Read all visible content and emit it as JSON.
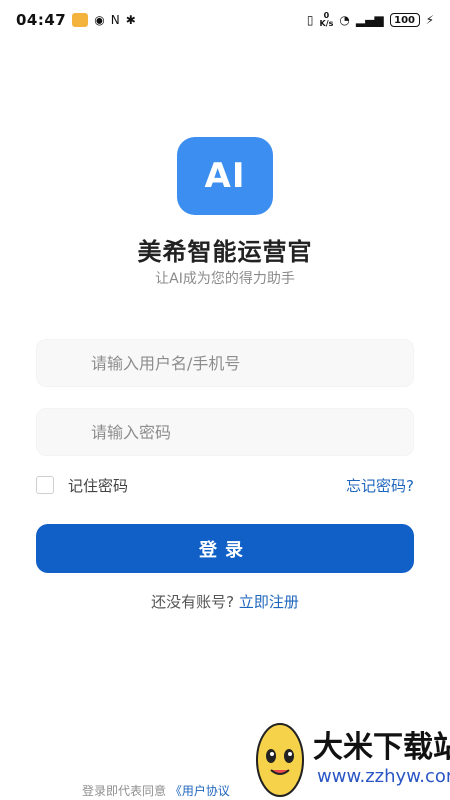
{
  "status_bar": {
    "time": "04:47",
    "speed_value": "0",
    "speed_unit": "K/s",
    "battery": "100"
  },
  "logo": {
    "text": "AI",
    "color": "#3c8ef0"
  },
  "app": {
    "name": "美希智能运营官",
    "tagline": "让AI成为您的得力助手"
  },
  "form": {
    "username_placeholder": "请输入用户名/手机号",
    "password_placeholder": "请输入密码",
    "remember_label": "记住密码",
    "forgot_link": "忘记密码?",
    "login_button": "登录",
    "no_account_text": "还没有账号?",
    "register_link": "立即注册"
  },
  "footer": {
    "agreement_text": "登录即代表同意",
    "agreement_link": "《用户协议"
  },
  "watermark": {
    "title": "大米下载站",
    "url": "www.zzhyw.com"
  },
  "colors": {
    "primary": "#1060c7",
    "link": "#1f66bd"
  }
}
